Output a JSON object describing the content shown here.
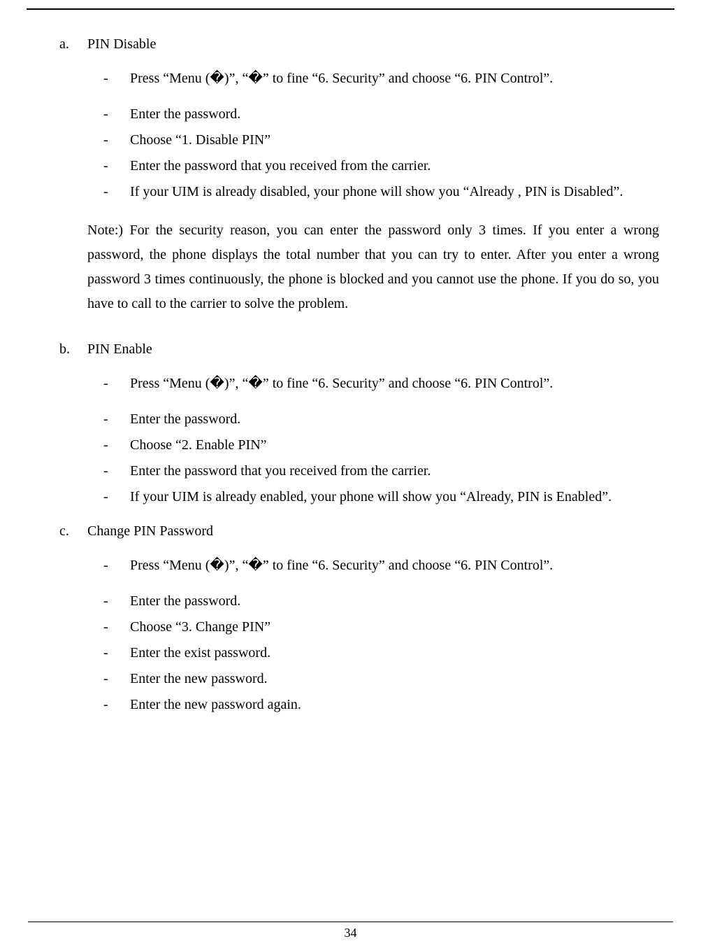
{
  "page_number": "34",
  "sections": [
    {
      "letter": "a.",
      "title": "PIN Disable",
      "steps": [
        "Press “Menu (�)”, “�” to fine “6. Security” and choose “6. PIN Control”.",
        "Enter the password.",
        "Choose “1. Disable PIN”",
        "Enter the password that you received from the carrier.",
        "If your UIM is already disabled, your phone will show you “Already , PIN is Disabled”."
      ]
    },
    {
      "letter": "b.",
      "title": "PIN Enable",
      "steps": [
        "Press “Menu (�)”, “�” to fine “6. Security” and choose “6. PIN Control”.",
        "Enter the password.",
        "Choose “2. Enable PIN”",
        "Enter the password that you received from the carrier.",
        "If your UIM is already enabled, your phone will show you “Already, PIN is Enabled”."
      ]
    },
    {
      "letter": "c.",
      "title": "Change PIN Password",
      "steps": [
        "Press “Menu (�)”, “�” to fine “6. Security” and choose “6. PIN Control”.",
        "Enter the password.",
        "Choose “3. Change PIN”",
        "Enter the exist password.",
        "Enter the new password.",
        "Enter the new password again."
      ]
    }
  ],
  "note": "Note:) For the security reason, you can enter the password only 3 times. If you enter a wrong password, the phone displays the total number that you can try to enter. After you enter a wrong password 3 times continuously, the phone is blocked and you cannot use the phone. If you do so, you have to call to the carrier to solve the problem."
}
